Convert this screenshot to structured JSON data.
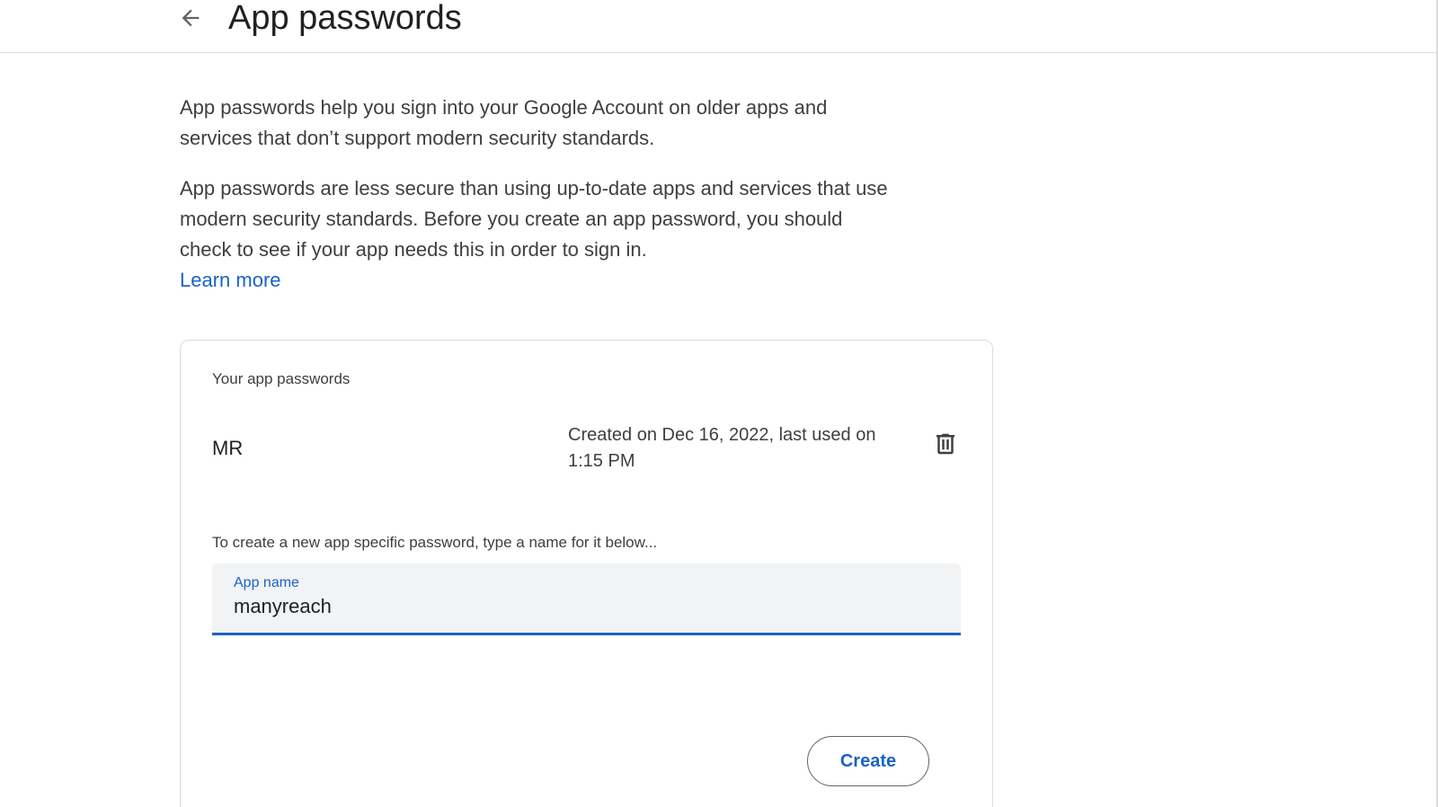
{
  "header": {
    "back_icon": "arrow-back-icon",
    "title": "App passwords"
  },
  "intro": {
    "paragraph_1": "App passwords help you sign into your Google Account on older apps and services that don’t support modern security standards.",
    "paragraph_2": "App passwords are less secure than using up-to-date apps and services that use modern security standards. Before you create an app password, you should check to see if your app needs this in order to sign in.",
    "learn_more": "Learn more"
  },
  "passwords_card": {
    "heading": "Your app passwords",
    "items": [
      {
        "name": "MR",
        "meta": "Created on Dec 16, 2022, last used on 1:15 PM",
        "delete_icon": "trash-icon"
      }
    ],
    "create_hint": "To create a new app specific password, type a name for it below...",
    "app_name_field": {
      "label": "App name",
      "value": "manyreach"
    },
    "create_label": "Create"
  },
  "colors": {
    "accent": "#1a63c7",
    "text": "#3c4043",
    "border": "#dadce0",
    "field_bg": "#f1f3f4"
  }
}
